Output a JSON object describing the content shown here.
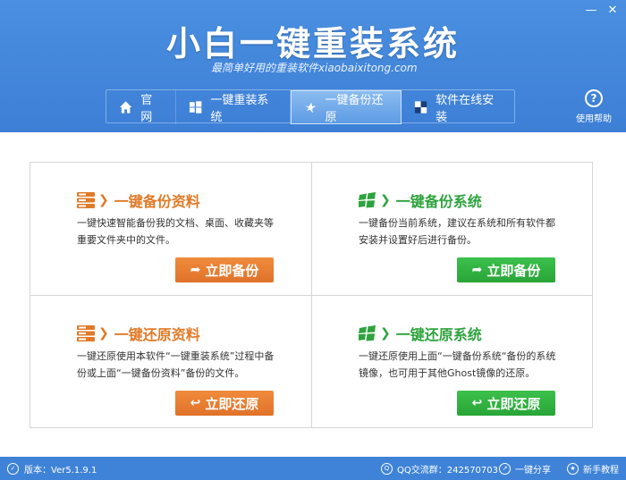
{
  "window": {
    "minimize": "—",
    "close": "✕"
  },
  "app": {
    "title": "小白一键重装系统",
    "subtitle": "最简单好用的重装软件xiaobaixitong.com"
  },
  "nav": {
    "tabs": [
      {
        "label": "官网"
      },
      {
        "label": "一键重装系统"
      },
      {
        "label": "一键备份还原"
      },
      {
        "label": "软件在线安装"
      }
    ],
    "active": "一键备份还原"
  },
  "help": {
    "symbol": "?",
    "label": "使用帮助"
  },
  "cards": {
    "backup_files": {
      "title": "一键备份资料",
      "desc": "一键快速智能备份我的文档、桌面、收藏夹等重要文件夹中的文件。",
      "button": "立即备份",
      "color": "#e07a28"
    },
    "backup_system": {
      "title": "一键备份系统",
      "desc": "一键备份当前系统，建议在系统和所有软件都安装并设置好后进行备份。",
      "button": "立即备份",
      "color": "#2ea33d"
    },
    "restore_files": {
      "title": "一键还原资料",
      "desc": "一键还原使用本软件“一键重装系统”过程中备份或上面“一键备份资料”备份的文件。",
      "button": "立即还原",
      "color": "#e07a28"
    },
    "restore_system": {
      "title": "一键还原系统",
      "desc": "一键还原使用上面“一键备份系统“备份的系统镜像，也可用于其他Ghost镜像的还原。",
      "button": "立即还原",
      "color": "#2ea33d"
    }
  },
  "status": {
    "version_label": "版本：Ver5.1.9.1",
    "qq_group": "QQ交流群：242570703",
    "share": "一键分享",
    "tutorial": "新手教程"
  }
}
